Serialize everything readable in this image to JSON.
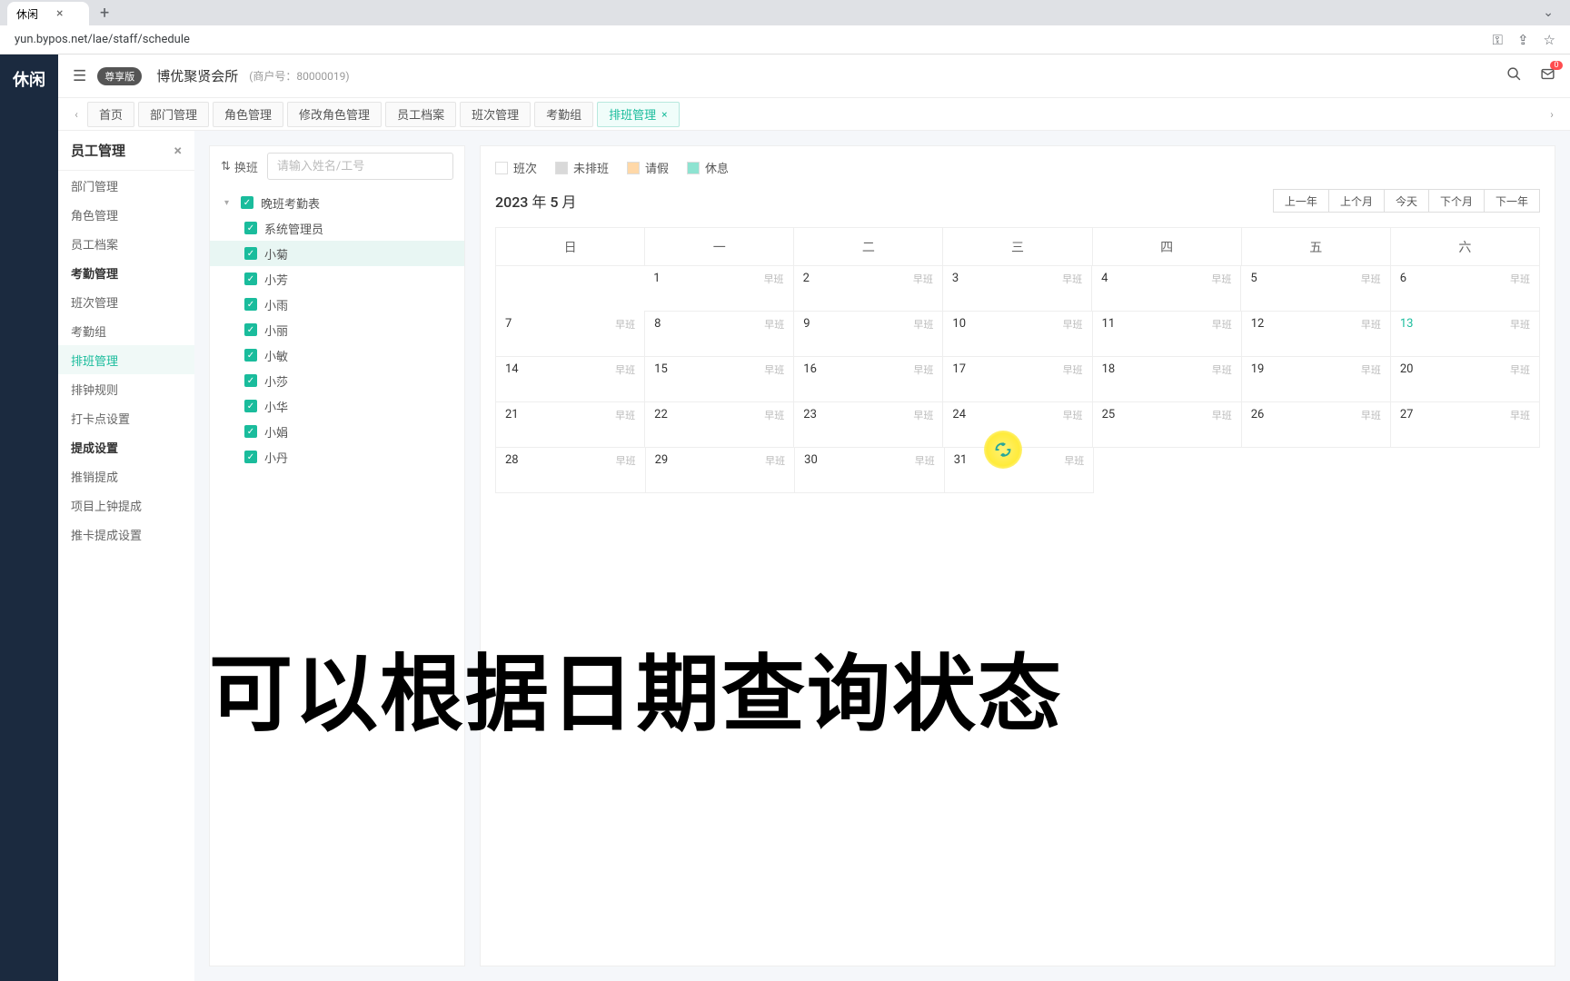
{
  "browser": {
    "tab_title": "休闲",
    "url": "yun.bypos.net/lae/staff/schedule"
  },
  "far_left_label": "休闲",
  "header": {
    "premium_badge": "尊享版",
    "company": "博优聚贤会所",
    "merchant_id": "(商户号：80000019)",
    "notif_count": "0"
  },
  "tabs": [
    "首页",
    "部门管理",
    "角色管理",
    "修改角色管理",
    "员工档案",
    "班次管理",
    "考勤组",
    "排班管理"
  ],
  "active_tab_index": 7,
  "sidebar": {
    "title": "员工管理",
    "items": [
      {
        "label": "部门管理",
        "type": "item"
      },
      {
        "label": "角色管理",
        "type": "item"
      },
      {
        "label": "员工档案",
        "type": "item"
      },
      {
        "label": "考勤管理",
        "type": "group"
      },
      {
        "label": "班次管理",
        "type": "item"
      },
      {
        "label": "考勤组",
        "type": "item"
      },
      {
        "label": "排班管理",
        "type": "item",
        "active": true
      },
      {
        "label": "排钟规则",
        "type": "item"
      },
      {
        "label": "打卡点设置",
        "type": "item"
      },
      {
        "label": "提成设置",
        "type": "group"
      },
      {
        "label": "推销提成",
        "type": "item"
      },
      {
        "label": "项目上钟提成",
        "type": "item"
      },
      {
        "label": "推卡提成设置",
        "type": "item"
      }
    ]
  },
  "tree": {
    "swap_label": "换班",
    "search_placeholder": "请输入姓名/工号",
    "root": "晚班考勤表",
    "children": [
      "系统管理员",
      "小菊",
      "小芳",
      "小雨",
      "小丽",
      "小敏",
      "小莎",
      "小华",
      "小娟",
      "小丹"
    ],
    "selected_index": 1
  },
  "legend": {
    "shift": "班次",
    "unscheduled": "未排班",
    "leave": "请假",
    "rest": "休息"
  },
  "calendar": {
    "month_title": "2023 年 5 月",
    "nav": [
      "上一年",
      "上个月",
      "今天",
      "下个月",
      "下一年"
    ],
    "weekdays": [
      "日",
      "一",
      "二",
      "三",
      "四",
      "五",
      "六"
    ],
    "shift_label": "早班",
    "today": 13,
    "rows": [
      [
        null,
        1,
        2,
        3,
        4,
        5,
        6
      ],
      [
        7,
        8,
        9,
        10,
        11,
        12,
        13
      ],
      [
        14,
        15,
        16,
        17,
        18,
        19,
        20
      ],
      [
        21,
        22,
        23,
        24,
        25,
        26,
        27
      ],
      [
        28,
        29,
        30,
        31,
        null,
        null,
        null
      ]
    ]
  },
  "caption": "可以根据日期查询状态"
}
